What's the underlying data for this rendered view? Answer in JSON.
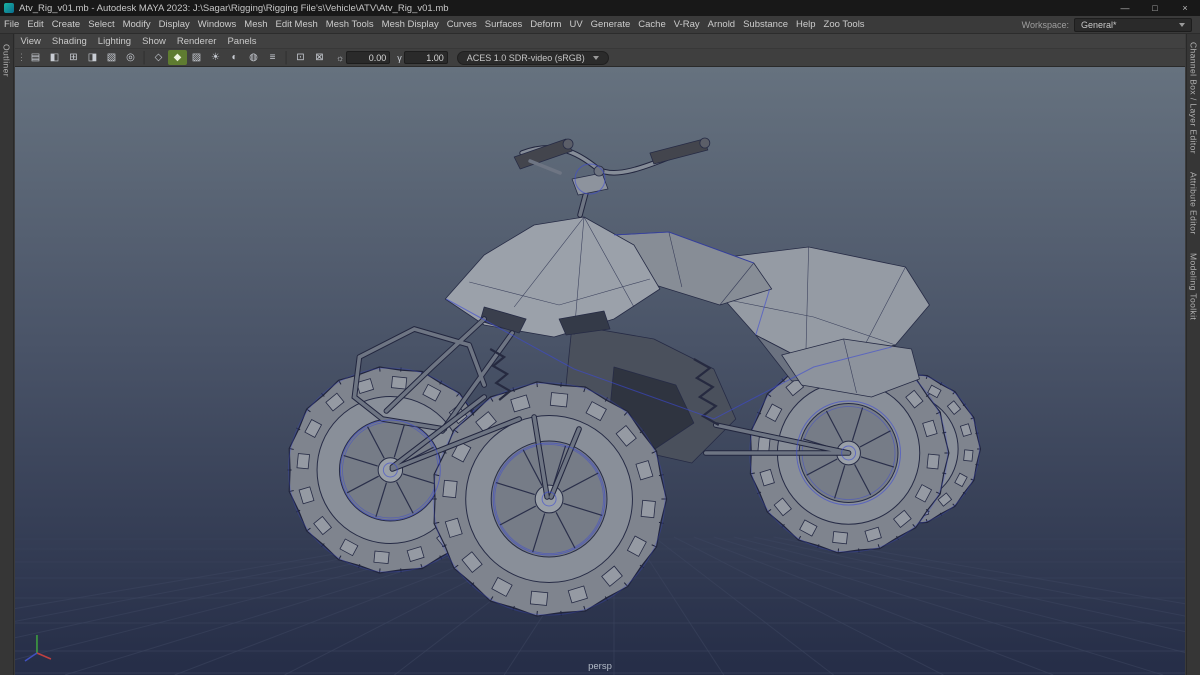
{
  "window": {
    "title": "Atv_Rig_v01.mb - Autodesk MAYA 2023: J:\\Sagar\\Rigging\\Rigging File's\\Vehicle\\ATV\\Atv_Rig_v01.mb",
    "controls": {
      "minimize": "—",
      "maximize": "□",
      "close": "×"
    }
  },
  "menubar": {
    "items": [
      "File",
      "Edit",
      "Create",
      "Select",
      "Modify",
      "Display",
      "Windows",
      "Mesh",
      "Edit Mesh",
      "Mesh Tools",
      "Mesh Display",
      "Curves",
      "Surfaces",
      "Deform",
      "UV",
      "Generate",
      "Cache",
      "V-Ray",
      "Arnold",
      "Substance",
      "Help",
      "Zoo Tools"
    ],
    "workspace_label": "Workspace:",
    "workspace_value": "General*"
  },
  "panel_menubar": {
    "items": [
      "View",
      "Shading",
      "Lighting",
      "Show",
      "Renderer",
      "Panels"
    ]
  },
  "statusline": {
    "icons": [
      {
        "name": "toolbar-drag-handle",
        "glyph": "⋮",
        "interactable": false
      },
      {
        "name": "select-camera-icon",
        "glyph": "▤"
      },
      {
        "name": "lock-camera-icon",
        "glyph": "◧"
      },
      {
        "name": "camera-attributes-icon",
        "glyph": "⊞"
      },
      {
        "name": "bookmarks-icon",
        "glyph": "◨"
      },
      {
        "name": "image-plane-icon",
        "glyph": "▧"
      },
      {
        "name": "pan-zoom-icon",
        "glyph": "◎"
      },
      {
        "name": "toolbar-separator",
        "glyph": "│",
        "interactable": false
      },
      {
        "name": "wireframe-mode-icon",
        "glyph": "◇"
      },
      {
        "name": "shaded-mode-icon",
        "glyph": "◆",
        "active": true
      },
      {
        "name": "textured-mode-icon",
        "glyph": "▨"
      },
      {
        "name": "use-all-lights-icon",
        "glyph": "☀"
      },
      {
        "name": "shadows-icon",
        "glyph": "◐"
      },
      {
        "name": "ambient-occlusion-icon",
        "glyph": "◍"
      },
      {
        "name": "anti-aliasing-icon",
        "glyph": "≡"
      },
      {
        "name": "toolbar-separator",
        "glyph": "│",
        "interactable": false
      },
      {
        "name": "isolate-select-icon",
        "glyph": "⊡"
      },
      {
        "name": "xray-icon",
        "glyph": "⊠"
      }
    ],
    "exposure_icon": "☼",
    "exposure_value": "0.00",
    "gamma_icon": "γ",
    "gamma_value": "1.00",
    "view_transform": "ACES 1.0 SDR-video (sRGB)"
  },
  "left_sidebar": {
    "tab": "Outliner"
  },
  "right_sidebar": {
    "tabs": [
      "Channel Box / Layer Editor",
      "Attribute Editor",
      "Modeling Toolkit"
    ]
  },
  "viewport": {
    "camera_label": "persp",
    "bg_top": "#66727f",
    "bg_mid": "#4a5468",
    "bg_bottom": "#252d47",
    "grid_color": "#3d4660",
    "model_gray": "#9ba1aa",
    "wireframe_accent": "#3c49d4",
    "axis_colors": {
      "x": "#c04040",
      "y": "#3fa43f",
      "z": "#4050c0"
    }
  }
}
